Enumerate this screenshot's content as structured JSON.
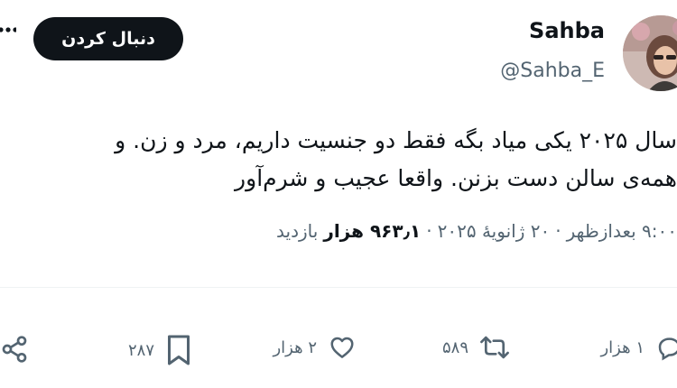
{
  "header": {
    "follow_label": "دنبال کردن",
    "display_name": "Sahba",
    "handle": "@Sahba_E",
    "more_icon": "more-horizontal-icon"
  },
  "tweet": {
    "line1": "سال ۲۰۲۵ یکی میاد بگه فقط دو جنسیت داریم، مرد و زن. و",
    "line2": "همه‌ی سالن دست بزنن. واقعا عجیب و شرم‌آور"
  },
  "meta": {
    "time": "۹:۰۰ بعدازظهر",
    "sep1": "·",
    "date": "۲۰ ژانویهٔ ۲۰۲۵",
    "sep2": "·",
    "views_count": "۹۶۳٫۱ هزار",
    "views_label": "بازدید"
  },
  "actions": {
    "reply_count": "۱ هزار",
    "retweet_count": "۵۸۹",
    "like_count": "۲ هزار",
    "bookmark_count": "۲۸۷"
  },
  "colors": {
    "text_primary": "#0f1419",
    "text_secondary": "#536471",
    "button_bg": "#0f1419",
    "button_text": "#ffffff"
  }
}
